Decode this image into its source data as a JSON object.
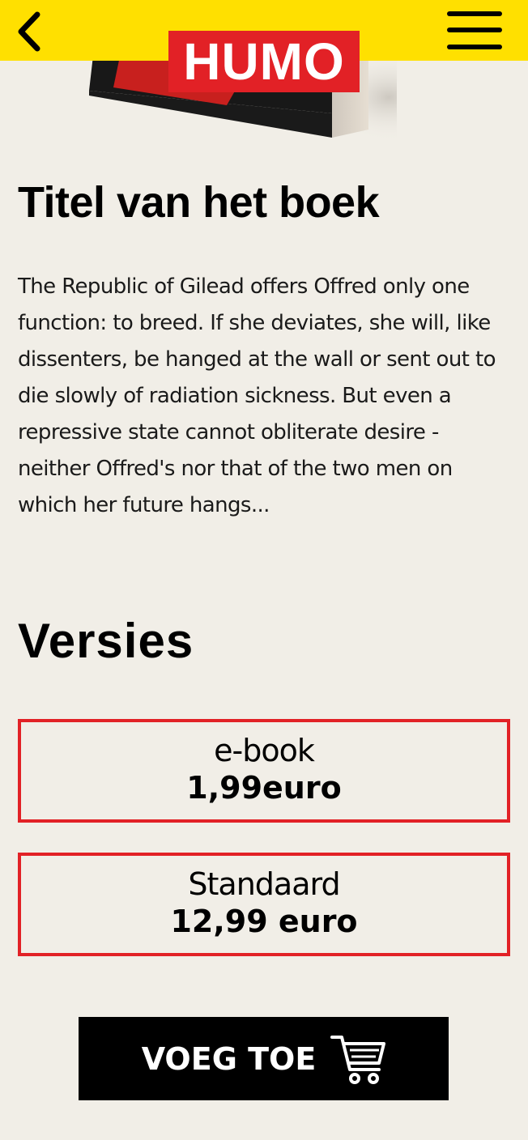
{
  "header": {
    "logo_text": "HUMO",
    "back_icon": "chevron-left-icon",
    "menu_icon": "hamburger-menu-icon",
    "background_color": "#ffe000"
  },
  "brand": {
    "accent_color": "#e22126"
  },
  "book": {
    "title": "Titel van het boek",
    "description": "The Republic of Gilead offers Offred only one function: to breed. If she deviates, she will, like dissenters, be hanged at the wall or sent out to die slowly of radiation sickness. But even a repressive state cannot obliterate desire - neither Offred's nor that of the two men on which her future hangs..."
  },
  "versions": {
    "heading": "Versies",
    "items": [
      {
        "name": "e-book",
        "price": "1,99euro"
      },
      {
        "name": "Standaard",
        "price": "12,99 euro"
      }
    ]
  },
  "cart_button": {
    "label": "VOEG TOE",
    "icon": "shopping-cart-icon"
  }
}
